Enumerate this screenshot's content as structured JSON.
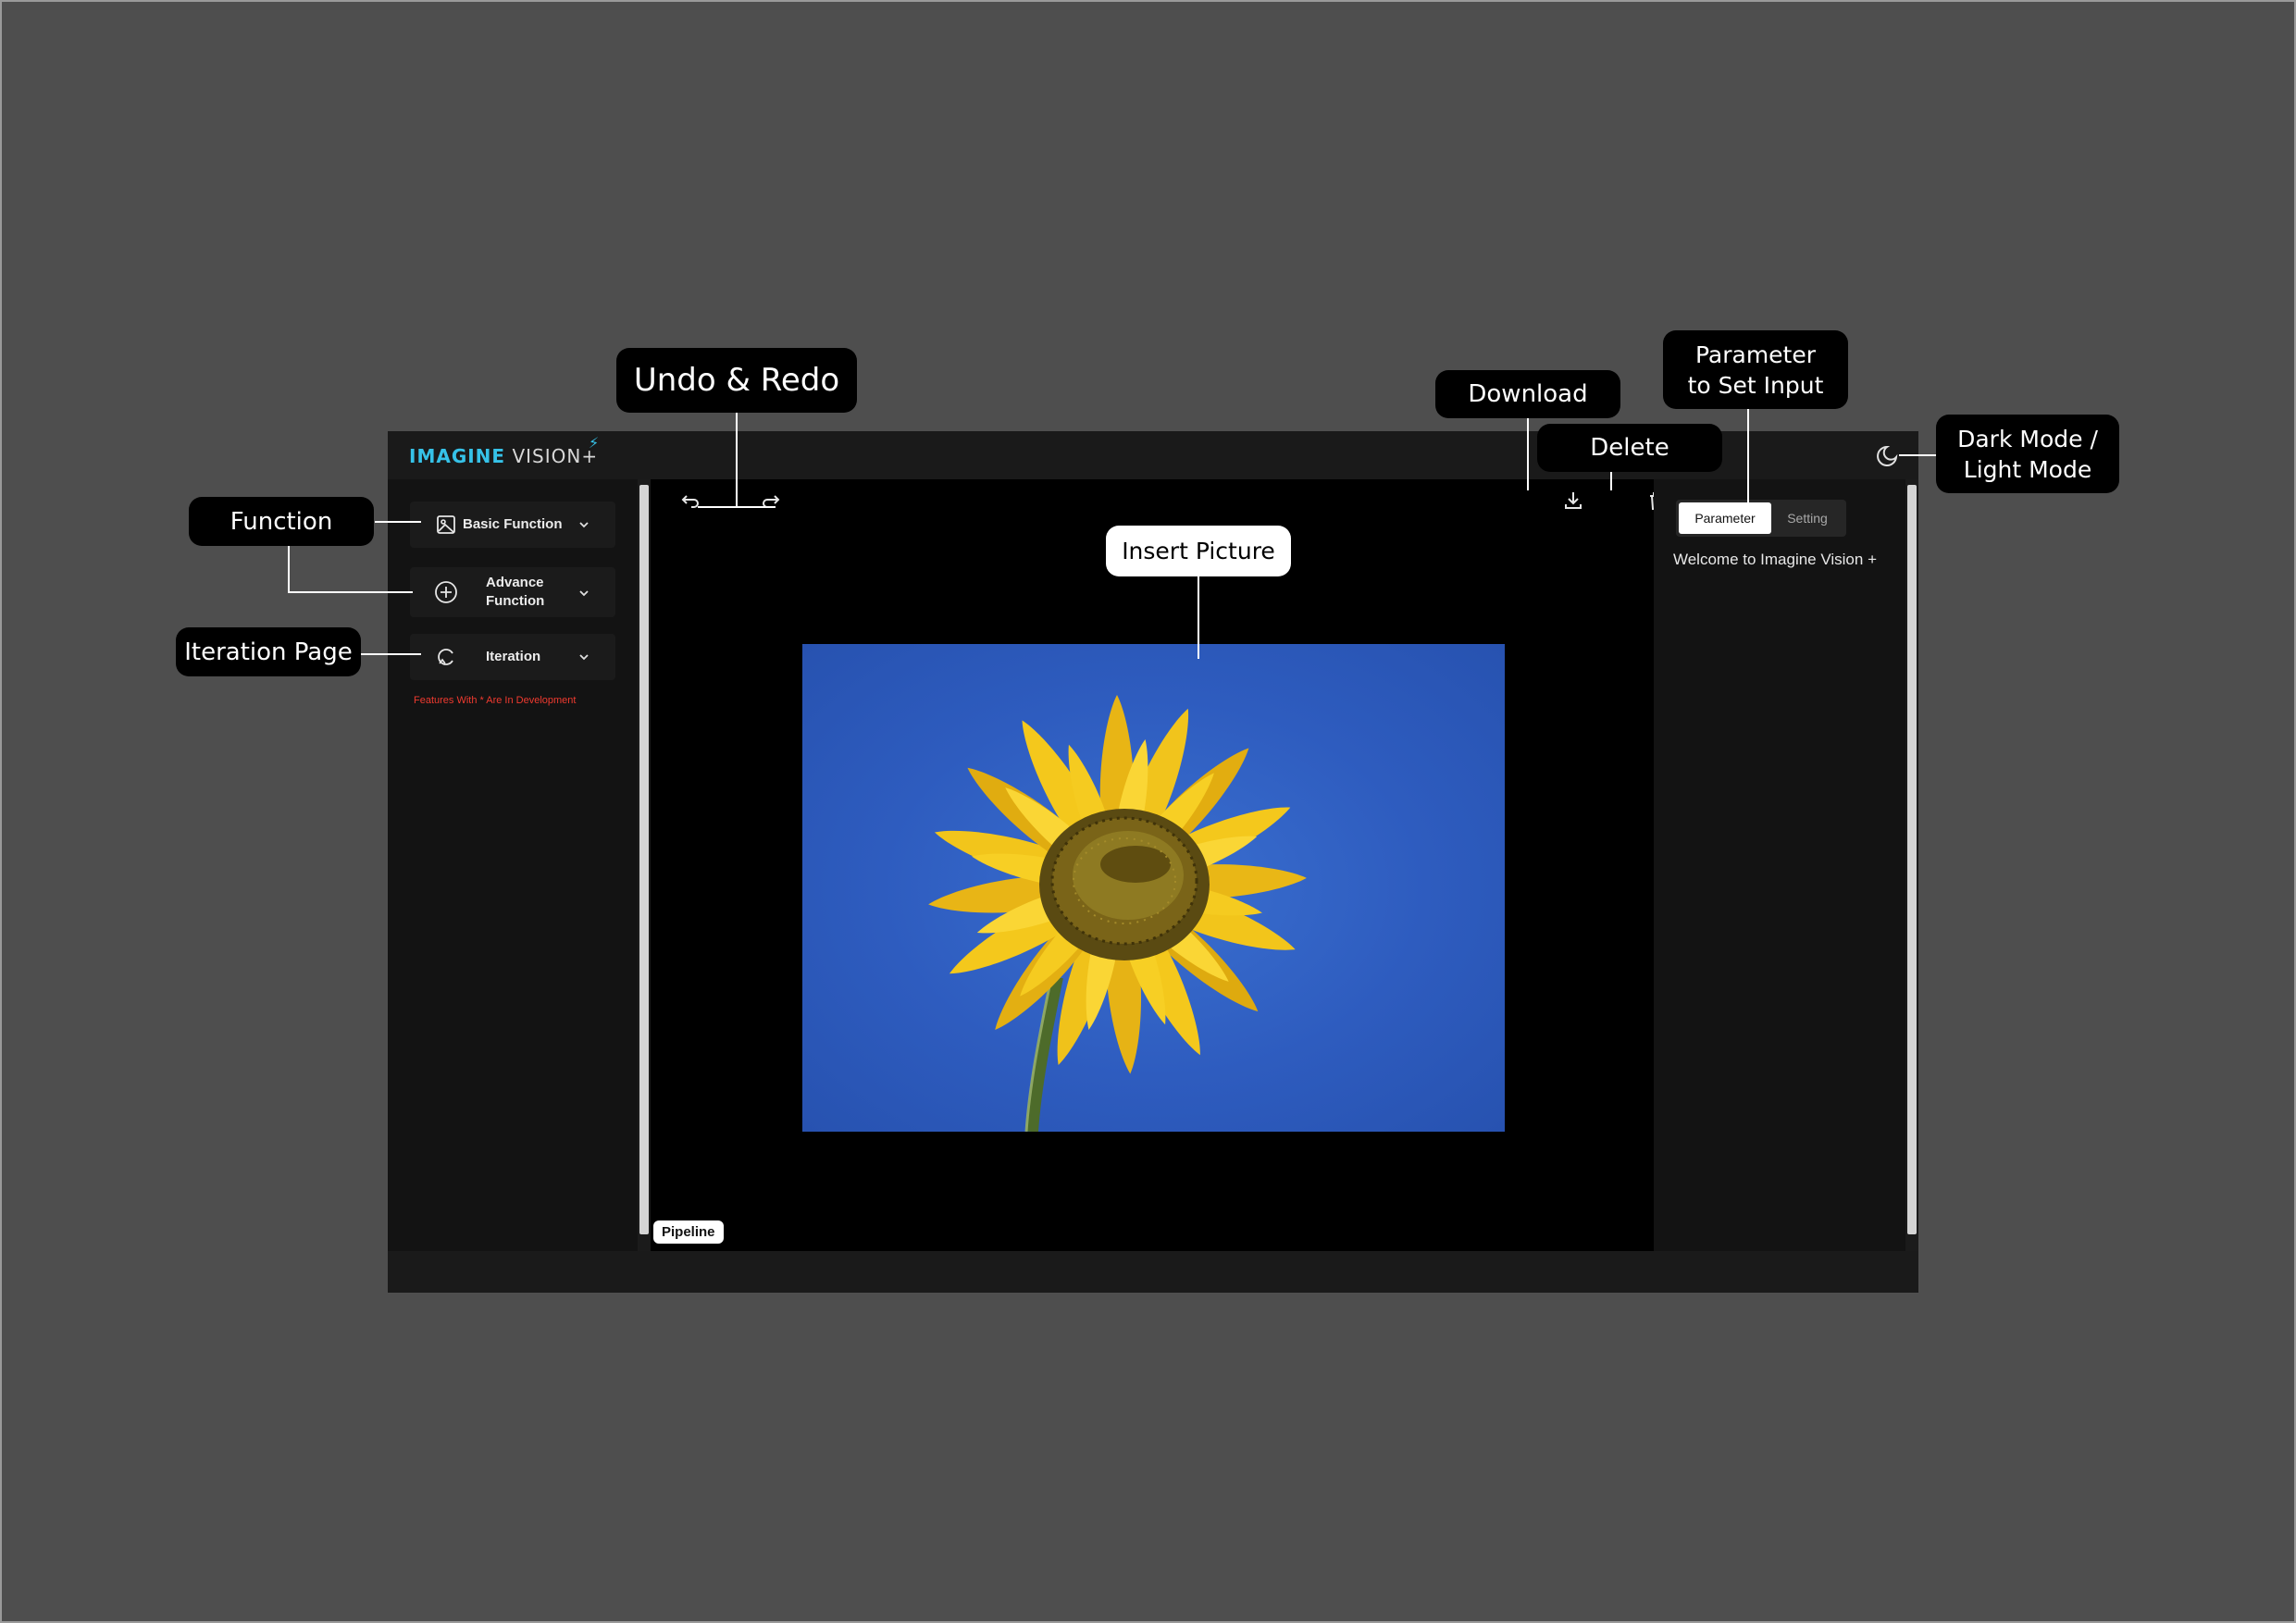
{
  "app": {
    "logo_main": "IMAGINE",
    "logo_sub": "VISION+",
    "logo_bolt": "⚡"
  },
  "sidebar": {
    "items": [
      {
        "label": "Basic Function",
        "icon": "image-icon"
      },
      {
        "label": "Advance Function",
        "icon": "plus-circle-icon"
      },
      {
        "label": "Iteration",
        "icon": "refresh-icon"
      }
    ],
    "dev_note": "Features With * Are In Development"
  },
  "canvas": {
    "pipeline_label": "Pipeline"
  },
  "right_panel": {
    "tabs": [
      "Parameter",
      "Setting"
    ],
    "active_tab": "Parameter",
    "welcome_text": "Welcome to Imagine Vision +"
  },
  "annotations": {
    "function": "Function",
    "iteration_page": "Iteration Page",
    "undo_redo": "Undo & Redo",
    "insert_picture": "Insert Picture",
    "download": "Download",
    "delete": "Delete",
    "parameter_input": "Parameter to Set Input",
    "dark_light_mode": "Dark Mode / Light Mode"
  },
  "colors": {
    "background": "#4e4e4e",
    "app_bg": "#131313",
    "accent": "#36c2e8",
    "warning": "#ef3a2f",
    "sky": "#2e5cbf",
    "petal": "#f4c81c"
  }
}
